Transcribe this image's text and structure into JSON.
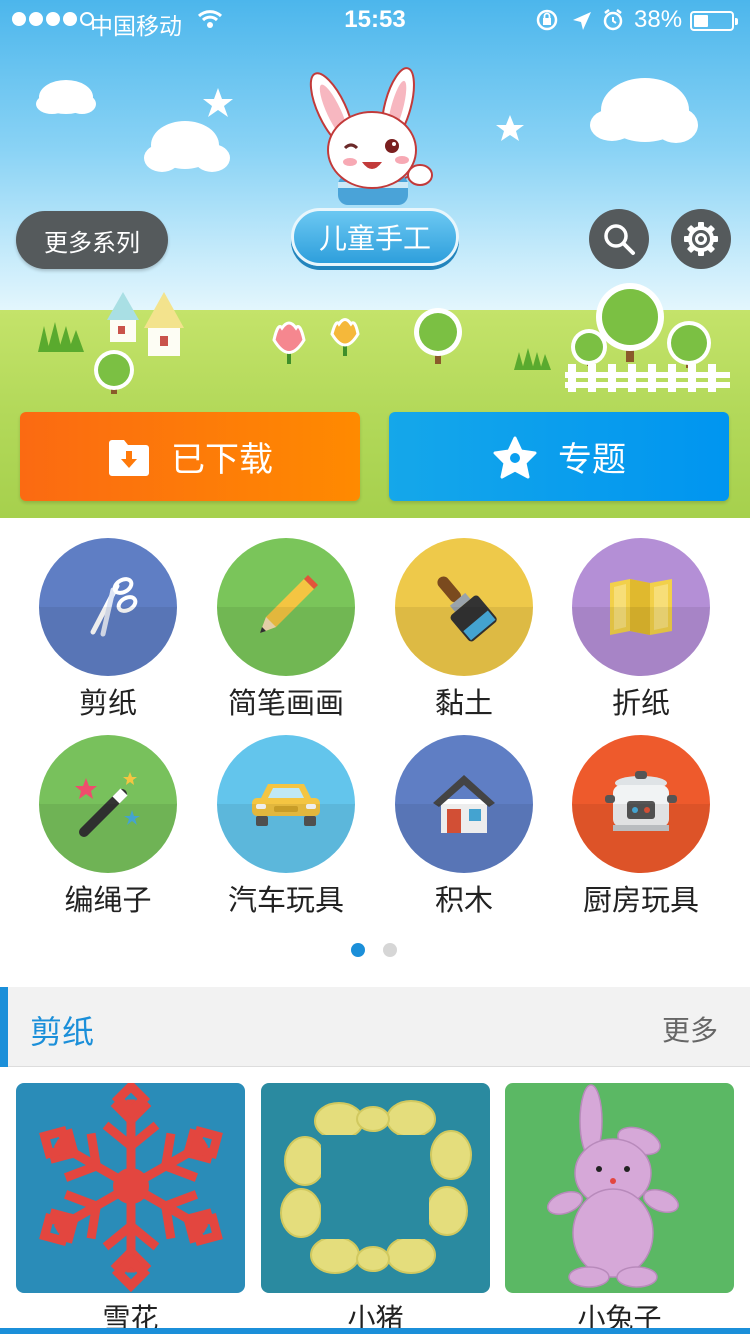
{
  "status_bar": {
    "carrier": "中国移动",
    "time": "15:53",
    "battery_percent": "38%",
    "battery_level": 0.38,
    "icons": [
      "signal-dots",
      "wifi-icon",
      "rotation-lock-icon",
      "location-arrow-icon",
      "alarm-icon",
      "battery-icon"
    ]
  },
  "header": {
    "more_series": "更多系列",
    "title": "儿童手工",
    "search_icon": "search-icon",
    "settings_icon": "gear-icon"
  },
  "actions": {
    "downloaded": {
      "label": "已下载",
      "icon": "folder-download-icon",
      "color": "#ff7a0a"
    },
    "topics": {
      "label": "专题",
      "icon": "star-icon",
      "color": "#0a9ff0"
    }
  },
  "categories": [
    {
      "label": "剪纸",
      "icon": "scissors-icon",
      "color": "#5f7ec4"
    },
    {
      "label": "简笔画画",
      "icon": "pencil-icon",
      "color": "#7ac55a"
    },
    {
      "label": "黏土",
      "icon": "paintbrush-icon",
      "color": "#eec94a"
    },
    {
      "label": "折纸",
      "icon": "folded-paper-icon",
      "color": "#b48fd6"
    },
    {
      "label": "编绳子",
      "icon": "magic-wand-icon",
      "color": "#78c15c"
    },
    {
      "label": "汽车玩具",
      "icon": "car-icon",
      "color": "#63c5ec"
    },
    {
      "label": "积木",
      "icon": "house-icon",
      "color": "#5f7ec4"
    },
    {
      "label": "厨房玩具",
      "icon": "rice-cooker-icon",
      "color": "#ee5a2c"
    }
  ],
  "pager": {
    "pages": 2,
    "current": 1
  },
  "section": {
    "title": "剪纸",
    "more": "更多",
    "items": [
      {
        "caption": "雪花",
        "image": "red-paper-snowflake"
      },
      {
        "caption": "小猪",
        "image": "yellow-paper-pig-ring"
      },
      {
        "caption": "小兔子",
        "image": "pink-paper-rabbit"
      }
    ]
  },
  "colors": {
    "accent": "#1b8fd9",
    "orange": "#ff7a0a",
    "blue": "#0a9ff0"
  }
}
